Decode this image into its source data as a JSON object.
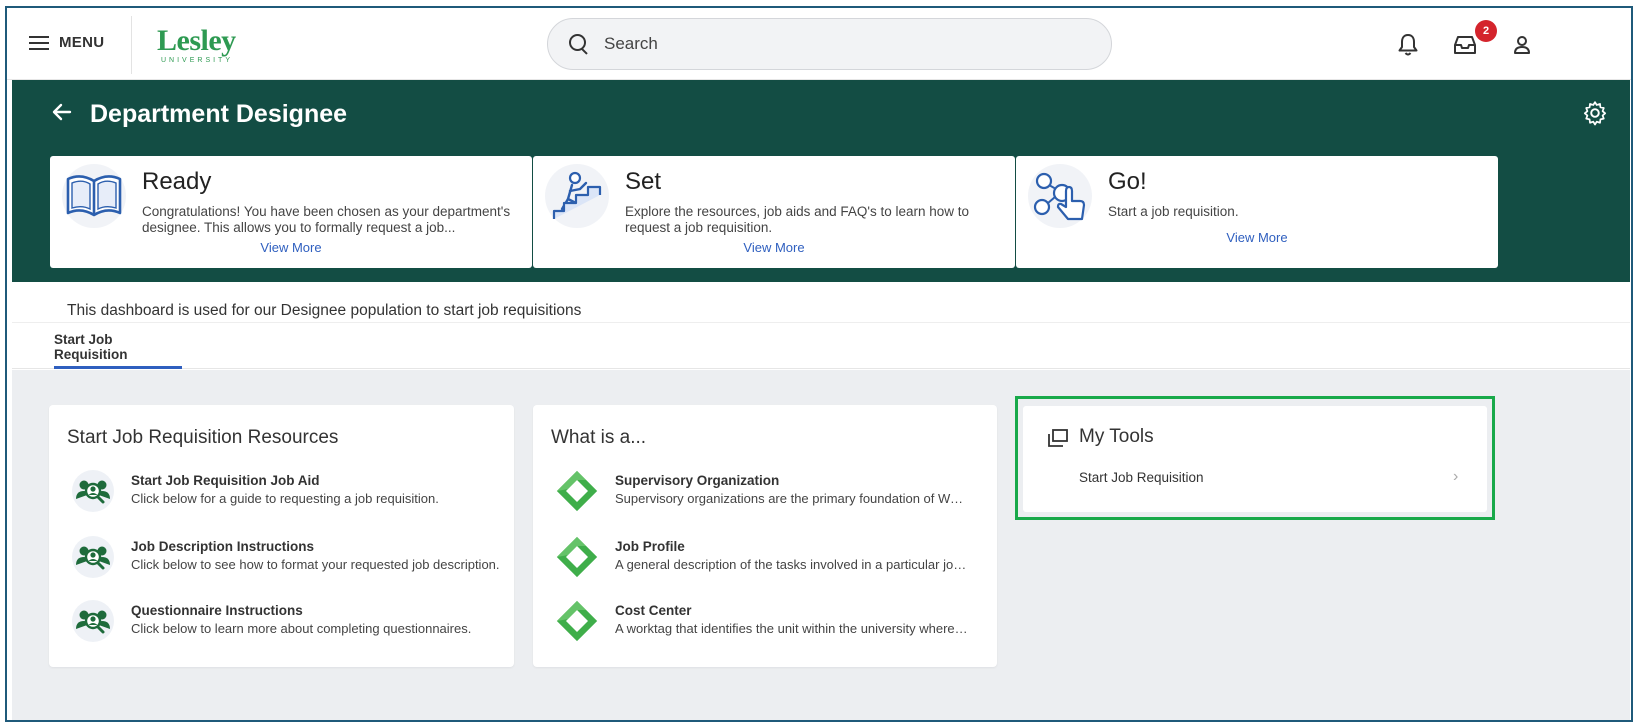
{
  "topbar": {
    "menu_label": "MENU",
    "logo_text": "Lesley",
    "logo_sub": "UNIVERSITY",
    "search_placeholder": "Search",
    "notification_count": "2"
  },
  "header": {
    "title": "Department Designee",
    "bg_color": "#134d44"
  },
  "hero_cards": [
    {
      "title": "Ready",
      "description": "Congratulations! You have been chosen as your department's designee. This allows you to formally request a job...",
      "link": "View More",
      "icon": "book-icon"
    },
    {
      "title": "Set",
      "description": "Explore the resources, job aids and FAQ's to learn how to request a job requisition.",
      "link": "View More",
      "icon": "climbing-stairs-icon"
    },
    {
      "title": "Go!",
      "description": "Start a job requisition.",
      "link": "View More",
      "icon": "touch-network-icon"
    }
  ],
  "intro_text": "This dashboard is used for our Designee population to start job requisitions",
  "tabs": [
    {
      "label": "Start Job Requisition",
      "active": true
    }
  ],
  "resources_panel": {
    "title": "Start Job Requisition Resources",
    "items": [
      {
        "title": "Start Job Requisition Job Aid",
        "description": "Click below for a guide to requesting a job requisition."
      },
      {
        "title": "Job Description Instructions",
        "description": "Click below to see how to format your requested job description."
      },
      {
        "title": "Questionnaire Instructions",
        "description": "Click below to learn more about completing questionnaires."
      }
    ]
  },
  "whatis_panel": {
    "title": "What is a...",
    "items": [
      {
        "title": "Supervisory Organization",
        "description": "Supervisory organizations are the primary foundation of Workd..."
      },
      {
        "title": "Job Profile",
        "description": "A general description of the tasks involved in a particular job, a..."
      },
      {
        "title": "Cost Center",
        "description": "A worktag that identifies the unit within the university where th..."
      }
    ]
  },
  "tools_panel": {
    "title": "My Tools",
    "items": [
      {
        "label": "Start Job Requisition"
      }
    ]
  },
  "colors": {
    "brand_green": "#2e9a52",
    "header_green": "#134d44",
    "link_blue": "#2f5fbf",
    "highlight_green": "#19a94a",
    "badge_red": "#d4242c"
  }
}
